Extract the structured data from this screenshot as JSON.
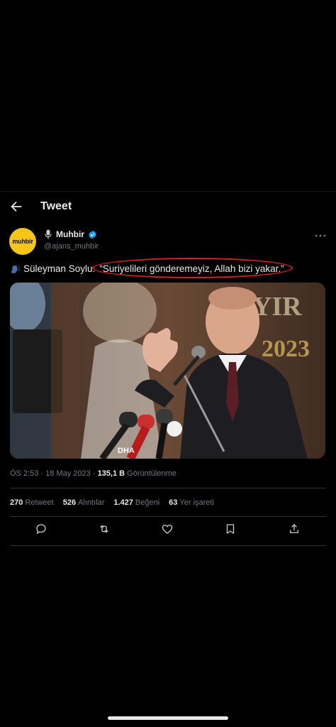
{
  "header": {
    "title": "Tweet"
  },
  "author": {
    "avatar_text": "muhbir",
    "name": "Muhbir",
    "handle": "@ajans_muhbir"
  },
  "tweet": {
    "prefix": "Süleyman Soylu:",
    "quote": "“Suriyelileri gönderemeyiz, Allah bizi yakar.”"
  },
  "photo": {
    "banner_text": "AYIR",
    "banner_year": "2023",
    "mic_label": "DHA"
  },
  "meta": {
    "time": "ÖS 2:53",
    "date": "18 May 2023",
    "separator": "·",
    "views_count": "135,1 B",
    "views_label": "Görüntülenme"
  },
  "stats": [
    {
      "count": "270",
      "label": "Retweet"
    },
    {
      "count": "526",
      "label": "Alıntılar"
    },
    {
      "count": "1.427",
      "label": "Beğeni"
    },
    {
      "count": "63",
      "label": "Yer işareti"
    }
  ],
  "actions": [
    "reply-icon",
    "retweet-icon",
    "like-icon",
    "bookmark-icon",
    "share-icon"
  ],
  "colors": {
    "background": "#000000",
    "text": "#e7e9ea",
    "secondary": "#71767b",
    "verified": "#1d9bf0",
    "avatar": "#f5c518",
    "highlight": "#d81d1d"
  }
}
